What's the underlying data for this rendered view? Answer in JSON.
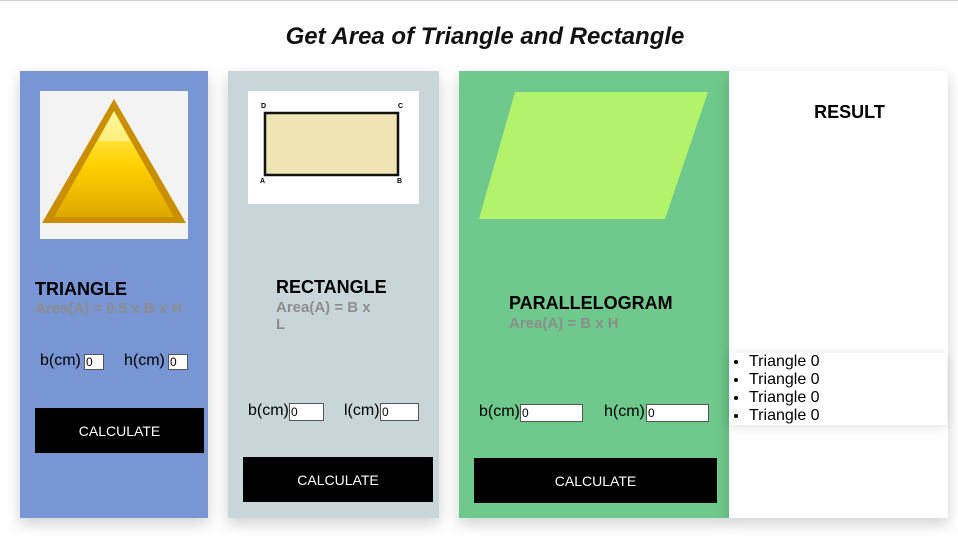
{
  "page": {
    "title": "Get Area of Triangle and Rectangle"
  },
  "triangle": {
    "title": "TRIANGLE",
    "formula": "Area(A) = 0.5 x B x H",
    "base_label": "b(cm)",
    "base_value": "0",
    "height_label": "h(cm)",
    "height_value": "0",
    "button": "CALCULATE"
  },
  "rectangle": {
    "title": "RECTANGLE",
    "formula_line1": "Area(A) = B x",
    "formula_line2": "L",
    "corner_labels": {
      "d": "D",
      "c": "C",
      "a": "A",
      "b": "B"
    },
    "base_label": "b(cm)",
    "base_value": "0",
    "length_label": "l(cm)",
    "length_value": "0",
    "button": "CALCULATE"
  },
  "parallelogram": {
    "title": "PARALLELOGRAM",
    "formula": "Area(A) = B x H",
    "base_label": "b(cm)",
    "base_value": "0",
    "height_label": "h(cm)",
    "height_value": "0",
    "button": "CALCULATE"
  },
  "result": {
    "title": "RESULT",
    "items": [
      "Triangle 0",
      "Triangle 0",
      "Triangle 0",
      "Triangle 0"
    ]
  },
  "colors": {
    "triangle_card": "#7895d4",
    "rectangle_card": "#c8d6da",
    "parallelogram_card": "#6fc98c",
    "parallelogram_shape": "#b3f26b",
    "button_bg": "#000000",
    "formula_text": "#8d8d8d"
  }
}
